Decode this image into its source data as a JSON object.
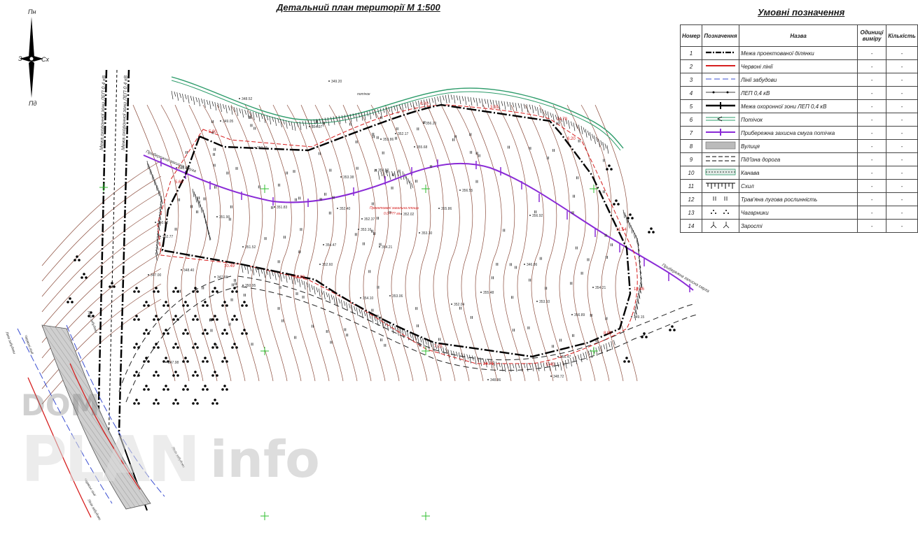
{
  "title": "Детальний план території М 1:500",
  "legend": {
    "title": "Умовні позначення",
    "headers": [
      "Номер",
      "Позначення",
      "Назва",
      "Одиниці виміру",
      "Кількість"
    ],
    "rows": [
      {
        "num": "1",
        "name": "Межа проектованої ділянки",
        "unit": "-",
        "qty": "-",
        "symbol": "plot-boundary"
      },
      {
        "num": "2",
        "name": "Червоні лінії",
        "unit": "-",
        "qty": "-",
        "symbol": "red-line"
      },
      {
        "num": "3",
        "name": "Лінії забудови",
        "unit": "-",
        "qty": "-",
        "symbol": "building-line"
      },
      {
        "num": "4",
        "name": "ЛЕП 0,4 кВ",
        "unit": "-",
        "qty": "-",
        "symbol": "power-line"
      },
      {
        "num": "5",
        "name": "Межа охоронної зони ЛЕП 0,4 кВ",
        "unit": "-",
        "qty": "-",
        "symbol": "protection-zone"
      },
      {
        "num": "6",
        "name": "Потічок",
        "unit": "-",
        "qty": "-",
        "symbol": "stream"
      },
      {
        "num": "7",
        "name": "Прибережна захисна смуга потічка",
        "unit": "-",
        "qty": "-",
        "symbol": "riparian-strip"
      },
      {
        "num": "8",
        "name": "Вулиця",
        "unit": "-",
        "qty": "-",
        "symbol": "street"
      },
      {
        "num": "9",
        "name": "Під'їзна дорога",
        "unit": "-",
        "qty": "-",
        "symbol": "access-road"
      },
      {
        "num": "10",
        "name": "Канава",
        "unit": "-",
        "qty": "-",
        "symbol": "ditch"
      },
      {
        "num": "11",
        "name": "Схил",
        "unit": "-",
        "qty": "-",
        "symbol": "slope"
      },
      {
        "num": "12",
        "name": "Трав'яна лугова рослинність",
        "unit": "-",
        "qty": "-",
        "symbol": "grass"
      },
      {
        "num": "13",
        "name": "Чагарники",
        "unit": "-",
        "qty": "-",
        "symbol": "shrubs"
      },
      {
        "num": "14",
        "name": "Зарості",
        "unit": "-",
        "qty": "-",
        "symbol": "thickets"
      }
    ]
  },
  "compass": {
    "north": "Пн",
    "south": "Пд",
    "west": "З",
    "east": "Сх"
  },
  "map_labels": {
    "zone_left_1": "Межа охоронної зони ЛЕП 0,4 кВ",
    "zone_left_2": "Межа охоронної зони ЛЕП 0,4 кВ",
    "riparian_left": "Прибережна захисна смуга",
    "riparian_right": "Прибережна захисна смуга",
    "stream": "потічок",
    "red_line_1": "Червоні лінії",
    "red_line_2": "Червоні лінії",
    "building_line_1": "Лінія забудови",
    "building_line_2": "Лінія забудови",
    "building_line_3": "Лінія забудови",
    "building_line_4": "Лінія забудови",
    "center_note": "Проектовані загальна площа",
    "center_note_2": "0.0 ??? га"
  },
  "elevations": [
    "349.20",
    "348.52",
    "349.05",
    "350.71",
    "351.83",
    "352.37",
    "354.50",
    "353.38",
    "356.20",
    "348.09",
    "350.02",
    "351.90",
    "354.97",
    "355.68",
    "353.86",
    "347.00",
    "348.40",
    "351.52",
    "354.47",
    "352.40",
    "356.55",
    "355.86",
    "352.77",
    "352.17",
    "353.16",
    "352.02",
    "354.21",
    "356.92",
    "354.10",
    "347.66",
    "350.95",
    "353.30",
    "352.60",
    "356.89",
    "348.86",
    "348.72",
    "346.86",
    "352.04",
    "353.10",
    "355.48",
    "356.47",
    "349.15",
    "353.06",
    "354.21",
    "347.98"
  ],
  "dimensions": [
    "5.00",
    "6.00",
    "3.59",
    "14.78",
    "6.20",
    "11.54",
    "18.46",
    "8.90",
    "24.71",
    "5.40",
    "7.25",
    "10.49",
    "36.98",
    "5.60"
  ],
  "watermark": {
    "part1": "DOM",
    "part2": "PLAN",
    "part3": "info"
  },
  "colors": {
    "boundary": "#000000",
    "red_line": "#d61f1f",
    "building_line": "#3b4fd1",
    "stream": "#2e9c6b",
    "riparian": "#8a2bd6",
    "contours": "#8a4a3a",
    "grid_cross": "#2fbf2f",
    "slope": "#222222"
  }
}
